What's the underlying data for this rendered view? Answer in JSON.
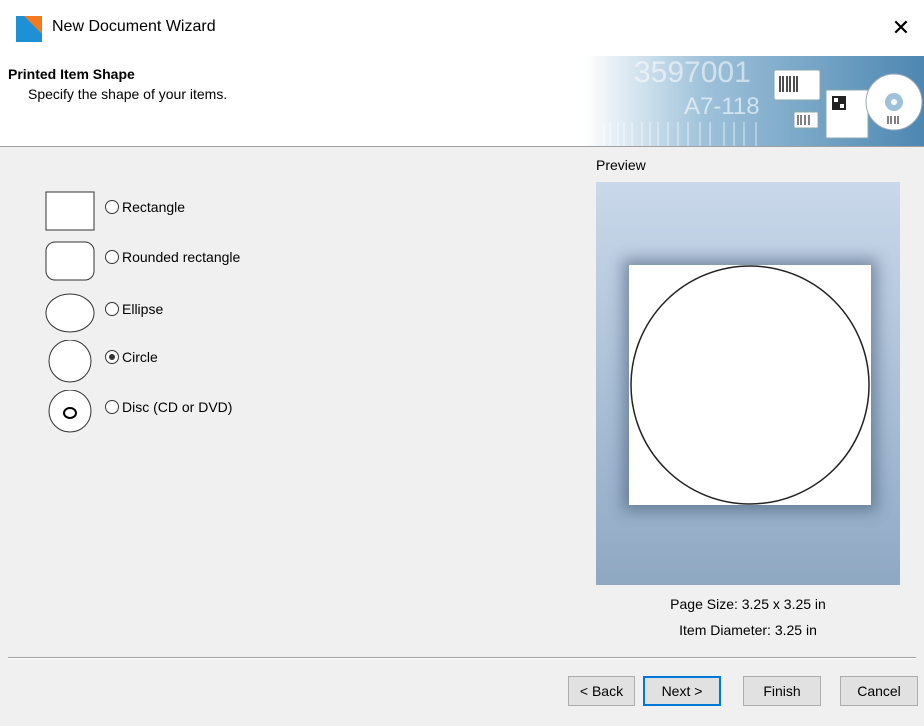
{
  "window": {
    "title": "New Document Wizard"
  },
  "header": {
    "heading": "Printed Item Shape",
    "subheading": "Specify the shape of your items.",
    "banner": {
      "number": "3597001",
      "code": "A7-118"
    }
  },
  "shapes": [
    {
      "label": "Rectangle",
      "selected": false
    },
    {
      "label": "Rounded rectangle",
      "selected": false
    },
    {
      "label": "Ellipse",
      "selected": false
    },
    {
      "label": "Circle",
      "selected": true
    },
    {
      "label": "Disc (CD or DVD)",
      "selected": false
    }
  ],
  "preview": {
    "label": "Preview",
    "page_size": "Page Size:  3.25 x 3.25 in",
    "item_diameter": "Item Diameter:  3.25 in"
  },
  "buttons": {
    "back": "< Back",
    "next": "Next >",
    "finish": "Finish",
    "cancel": "Cancel"
  },
  "colors": {
    "accent": "#0078d7",
    "logo_blue": "#1e90d6",
    "logo_orange": "#f47a20"
  }
}
